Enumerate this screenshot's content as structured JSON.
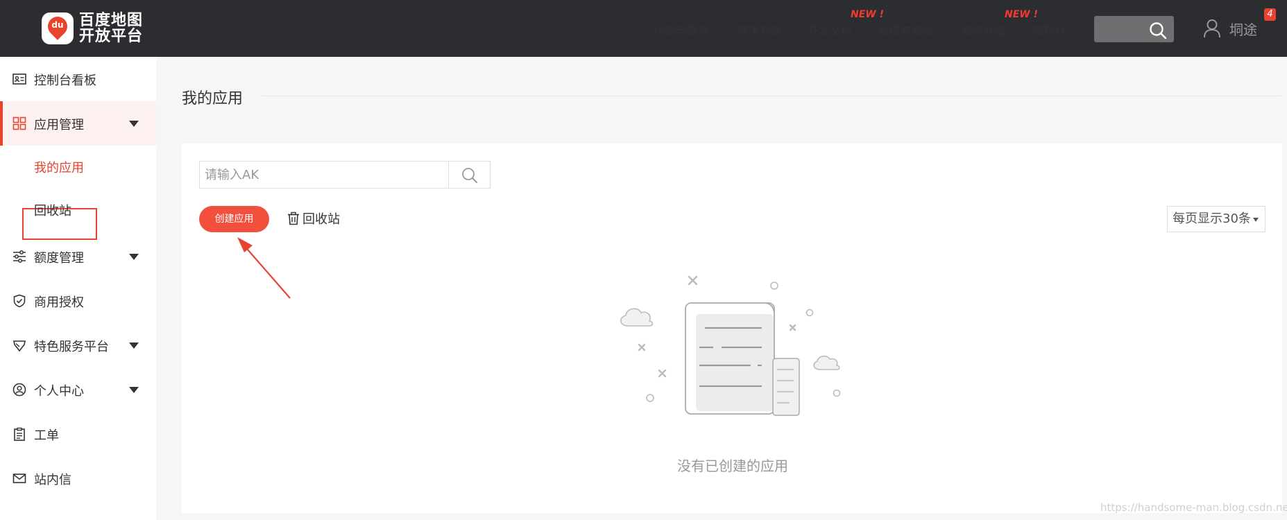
{
  "brand": {
    "logo_badge_text": "du",
    "name_line1": "百度地图",
    "name_line2": "开放平台"
  },
  "top_nav": {
    "items": [
      {
        "label": "功能与服务"
      },
      {
        "label": "解决方案"
      },
      {
        "label": "开发文档",
        "tag": "NEW !"
      },
      {
        "label": "反馈与帮助"
      },
      {
        "label": "服务升级",
        "tag": "NEW !"
      },
      {
        "label": "控制台"
      }
    ],
    "user_name": "垌途",
    "notification_count": "4"
  },
  "sidebar": {
    "items": [
      {
        "label": "控制台看板",
        "icon": "dashboard-card-icon"
      },
      {
        "label": "应用管理",
        "icon": "grid-apps-icon",
        "expanded": true
      },
      {
        "label": "额度管理",
        "icon": "sliders-icon"
      },
      {
        "label": "商用授权",
        "icon": "shield-check-icon"
      },
      {
        "label": "特色服务平台",
        "icon": "gem-icon"
      },
      {
        "label": "个人中心",
        "icon": "user-circle-icon"
      },
      {
        "label": "工单",
        "icon": "clipboard-icon"
      },
      {
        "label": "站内信",
        "icon": "mail-icon"
      }
    ],
    "app_sub_items": [
      {
        "label": "我的应用",
        "selected": true
      },
      {
        "label": "回收站"
      }
    ]
  },
  "main": {
    "title": "我的应用",
    "search_placeholder": "请输入AK",
    "search_value": "",
    "create_button": "创建应用",
    "recycle_link": "回收站",
    "per_page": "每页显示30条",
    "empty_text": "没有已创建的应用"
  },
  "watermark": "https://handsome-man.blog.csdn.net",
  "colors": {
    "topbar": "#2b2d30",
    "accent": "#e8432f",
    "button": "#f2503d",
    "sidebar_active_bg": "#fdf2f1",
    "page_bg": "#f5f6f7"
  }
}
